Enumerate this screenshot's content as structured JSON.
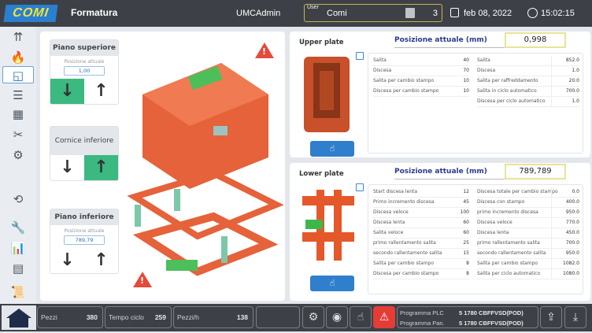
{
  "header": {
    "logo": "COMI",
    "title": "Formatura",
    "user_role": "UMCAdmin",
    "user_label": "User",
    "user_name": "Comi",
    "user_count": "3",
    "date": "feb 08, 2022",
    "time": "15:02:15"
  },
  "sidebar": {
    "items": [
      {
        "icon": "lift-icon",
        "glyph": "⇈"
      },
      {
        "icon": "flame-icon",
        "glyph": "🔥"
      },
      {
        "icon": "frame-icon",
        "glyph": "◱",
        "active": true
      },
      {
        "icon": "list-icon",
        "glyph": "☰"
      },
      {
        "icon": "conveyor-icon",
        "glyph": "▦"
      },
      {
        "icon": "cutter-icon",
        "glyph": "✂"
      },
      {
        "icon": "robot-icon",
        "glyph": "⚙"
      },
      {
        "icon": "cycle-icon",
        "glyph": "⟲"
      },
      {
        "icon": "wrench-icon",
        "glyph": "🔧"
      },
      {
        "icon": "chart-icon",
        "glyph": "📊"
      },
      {
        "icon": "motor-icon",
        "glyph": "▤"
      },
      {
        "icon": "scroll-icon",
        "glyph": "📜"
      }
    ]
  },
  "controls": [
    {
      "title": "Piano superiore",
      "pos_label": "Posizione attuale",
      "pos_value": "1,00",
      "active": "down"
    },
    {
      "title": "Cornice inferiore",
      "active": "up"
    },
    {
      "title": "Piano inferiore",
      "pos_label": "Posizione attuale",
      "pos_value": "789,79",
      "active": "none"
    }
  ],
  "upper": {
    "title": "Upper plate",
    "pos_label": "Posizione attuale (mm)",
    "pos_value": "0,998",
    "left": [
      [
        "Salita",
        "40"
      ],
      [
        "Discesa",
        "70"
      ],
      [
        "Salita per cambio stampo",
        "10"
      ],
      [
        "Discesa per cambio stampo",
        "10"
      ]
    ],
    "right": [
      [
        "Salita",
        "852.0"
      ],
      [
        "Discesa",
        "1.0"
      ],
      [
        "Salita per raffreddamento",
        "20.0"
      ],
      [
        "Salita in ciclo automatico",
        "700.0"
      ],
      [
        "Discesa per ciclo automatico",
        "1.0"
      ]
    ]
  },
  "lower": {
    "title": "Lower plate",
    "pos_label": "Posizione attuale (mm)",
    "pos_value": "789,789",
    "left": [
      [
        "Start discesa lenta",
        "12"
      ],
      [
        "Primo incremento discesa",
        "45"
      ],
      [
        "Discesa veloce",
        "100"
      ],
      [
        "Discesa lenta",
        "60"
      ],
      [
        "Salita veloce",
        "60"
      ],
      [
        "primo rallentamento salita",
        "25"
      ],
      [
        "secondo rallentamento salita",
        "15"
      ],
      [
        "Salita per cambio stampo",
        "8"
      ],
      [
        "Discesa per cambio stampo",
        "8"
      ]
    ],
    "right": [
      [
        "Discesa totale per cambio stampo",
        "0.0"
      ],
      [
        "Discesa con stampo",
        "400.0"
      ],
      [
        "primo incremento discesa",
        "950.0"
      ],
      [
        "Discesa veloce",
        "770.0"
      ],
      [
        "Discesa lenta",
        "450.0"
      ],
      [
        "primo rallentamento salita",
        "700.0"
      ],
      [
        "secondo rallentamento salita",
        "950.0"
      ],
      [
        "Salita per cambio stampo",
        "1082.0"
      ],
      [
        "Salita per ciclo automatico",
        "1080.0"
      ]
    ]
  },
  "footer": {
    "pezzi_label": "Pezzi",
    "pezzi": "380",
    "tempo_label": "Tempo ciclo",
    "tempo": "259",
    "pezzih_label": "Pezzi/h",
    "pezzih": "138",
    "prog_plc_label": "Programma PLC",
    "prog_plc": "5  1780 CBFFVSD(POD)",
    "prog_pan_label": "Programma Pan.",
    "prog_pan": "5  1780 CBFFVSD(POD)"
  },
  "colors": {
    "accent": "#2f7fcc",
    "active_button": "#3cb881",
    "alarm": "#e64a3a",
    "header": "#3d4147"
  }
}
